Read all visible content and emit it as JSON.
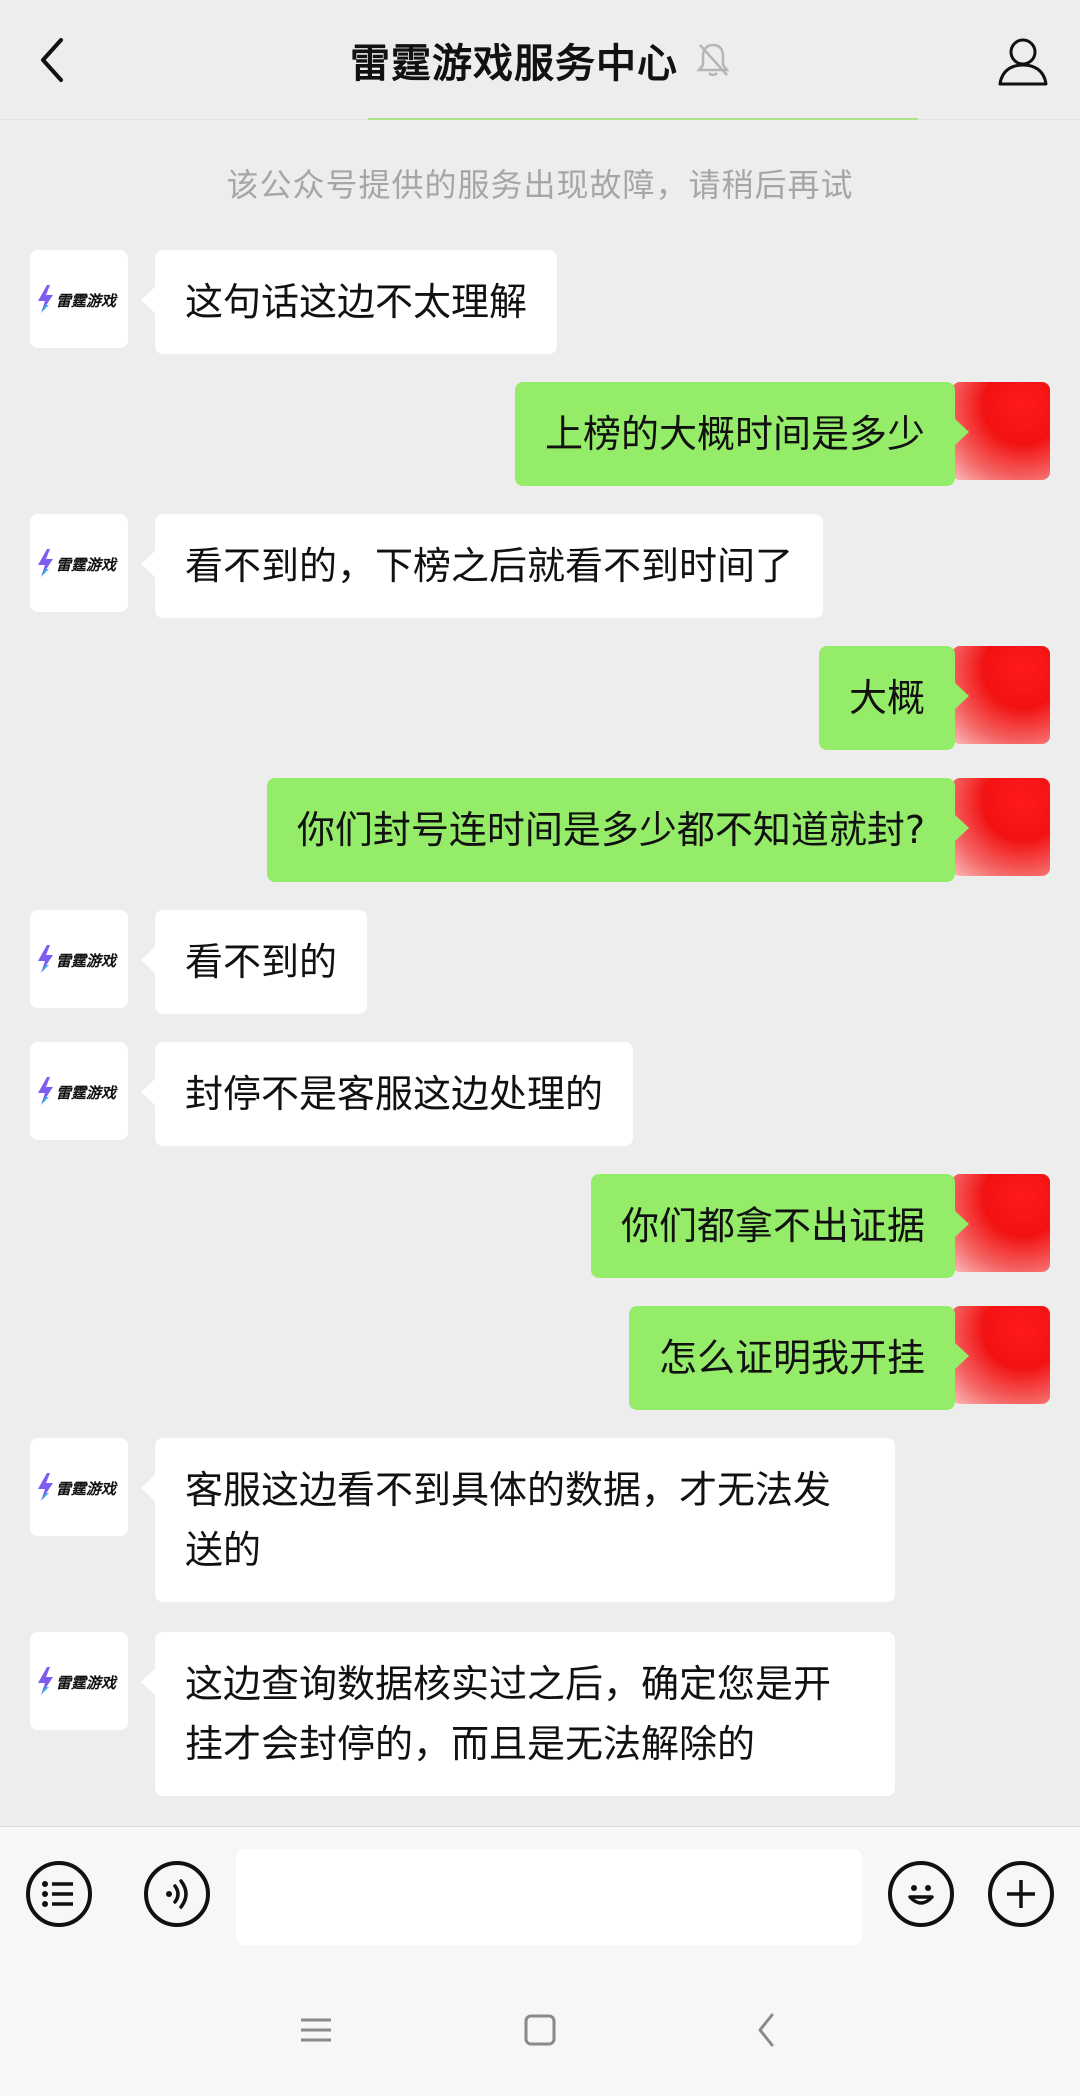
{
  "header": {
    "title": "雷霆游戏服务中心",
    "icons": {
      "back": "chevron-left-icon",
      "mute": "bell-muted-icon",
      "profile": "person-icon"
    }
  },
  "notice": "该公众号提供的服务出现故障，请稍后再试",
  "bot_avatar_text": "雷霆游戏",
  "messages": [
    {
      "from": "bot",
      "text": "这句话这边不太理解"
    },
    {
      "from": "user",
      "text": "上榜的大概时间是多少"
    },
    {
      "from": "bot",
      "text": "看不到的，下榜之后就看不到时间了"
    },
    {
      "from": "user",
      "text": "大概"
    },
    {
      "from": "user",
      "text": "你们封号连时间是多少都不知道就封?"
    },
    {
      "from": "bot",
      "text": "看不到的"
    },
    {
      "from": "bot",
      "text": "封停不是客服这边处理的"
    },
    {
      "from": "user",
      "text": "你们都拿不出证据"
    },
    {
      "from": "user",
      "text": "怎么证明我开挂"
    },
    {
      "from": "bot",
      "text": "客服这边看不到具体的数据，才无法发送的"
    },
    {
      "from": "bot",
      "text": "这边查询数据核实过之后，确定您是开挂才会封停的，而且是无法解除的"
    }
  ],
  "input_bar": {
    "input_value": "",
    "icons": {
      "menu": "list-icon",
      "voice": "voice-icon",
      "emoji": "smiley-icon",
      "more": "plus-icon"
    }
  },
  "system_nav": {
    "icons": {
      "menu": "menu-lines-icon",
      "home": "square-home-icon",
      "back": "chevron-left-icon"
    }
  },
  "colors": {
    "background": "#ededed",
    "bubble_user": "#95ec69",
    "bubble_bot": "#ffffff",
    "notice_text": "#a6a6a6",
    "accent_line": "#a9e28a"
  }
}
